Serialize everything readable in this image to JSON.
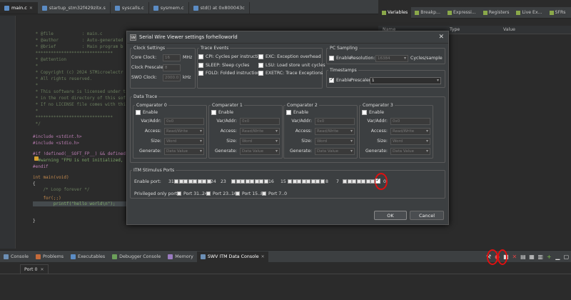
{
  "editor_tabs": [
    {
      "label": "main.c",
      "active": true
    },
    {
      "label": "startup_stm32f429zitx.s",
      "active": false
    },
    {
      "label": "syscalls.c",
      "active": false
    },
    {
      "label": "sysmem.c",
      "active": false
    },
    {
      "label": "std() at 0x800043c",
      "active": false
    }
  ],
  "view_tabs": [
    {
      "label": "Variables",
      "active": true
    },
    {
      "label": "Breakp...",
      "active": false
    },
    {
      "label": "Expressi...",
      "active": false
    },
    {
      "label": "Registers",
      "active": false
    },
    {
      "label": "Live Ex...",
      "active": false
    },
    {
      "label": "SFRs",
      "active": false
    }
  ],
  "variables_header": {
    "name": "Name",
    "type": "Type",
    "value": "Value"
  },
  "code_lines": {
    "l1": " * @file           : main.c",
    "l2": " * @author         : Auto-generated",
    "l3": " * @brief          : Main program b",
    "l4": " ******************************",
    "l5": " * @attention",
    "l6": " *",
    "l7": " * Copyright (c) 2024 STMicroelectr",
    "l8": " * All rights reserved.",
    "l9": " *",
    "l10": " * This software is licensed under t",
    "l11": " * in the root directory of this sof",
    "l12": " * If no LICENSE file comes with thi",
    "l13": " *",
    "l14": " ******************************",
    "l15": " */",
    "l16": "#include <stdint.h>",
    "l17": "#include <stdio.h>",
    "l18": "#if !defined(__SOFT_FP__) && defined",
    "l19": "  #warning \"FPU is not initialized,",
    "l20": "#endif",
    "l21": "int main(void)",
    "l22": "{",
    "l23": "    /* Loop forever */",
    "l24": "    for(;;)",
    "l25": "        printf(\"hello world\\n\");",
    "l26": "}"
  },
  "dialog": {
    "title": "Serial Wire Viewer settings forhelloworld",
    "clock": {
      "legend": "Clock Settings",
      "core_label": "Core Clock:",
      "core_value": "16",
      "core_unit": "MHz",
      "prescaler_label": "Clock Prescaler:",
      "prescaler_value": "8",
      "swo_label": "SWO Clock:",
      "swo_value": "2000.0",
      "swo_unit": "kHz"
    },
    "trace": {
      "legend": "Trace Events",
      "cpi": "CPI: Cycles per instruction",
      "exc": "EXC: Exception overhead",
      "sleep": "SLEEP: Sleep cycles",
      "lsu": "LSU: Load store unit cycles",
      "fold": "FOLD: Folded instructions",
      "exetrc": "EXETRC: Trace Exceptions"
    },
    "pc": {
      "legend": "PC Sampling",
      "enable": "Enable",
      "resolution_label": "Resolution:",
      "resolution_value": "16384",
      "unit": "Cycles/sample"
    },
    "timestamps": {
      "legend": "Timestamps",
      "enable": "Enable",
      "prescaler_label": "Prescaler:",
      "prescaler_value": "1"
    },
    "data_trace": {
      "legend": "Data Trace",
      "comparators": [
        {
          "title": "Comparator 0"
        },
        {
          "title": "Comparator 1"
        },
        {
          "title": "Comparator 2"
        },
        {
          "title": "Comparator 3"
        }
      ],
      "enable": "Enable",
      "var_label": "Var/Addr:",
      "var_value": "0x0",
      "access_label": "Access:",
      "access_value": "Read/Write",
      "size_label": "Size:",
      "size_value": "Word",
      "generate_label": "Generate:",
      "generate_value": "Data Value"
    },
    "itm": {
      "legend": "ITM Stimulus Ports",
      "enable_port_label": "Enable port:",
      "n31": "31",
      "n24": "24",
      "n23": "23",
      "n16": "16",
      "n15": "15",
      "n8": "8",
      "n7": "7",
      "n0": "0",
      "privileged_label": "Privileged only ports:",
      "priv_ports": [
        "Port 31..24",
        "Port 23..16",
        "Port 15..8",
        "Port 7..0"
      ]
    },
    "ok": "OK",
    "cancel": "Cancel"
  },
  "bottom_tabs": [
    {
      "label": "Console",
      "active": false
    },
    {
      "label": "Problems",
      "active": false
    },
    {
      "label": "Executables",
      "active": false
    },
    {
      "label": "Debugger Console",
      "active": false
    },
    {
      "label": "Memory",
      "active": false
    },
    {
      "label": "SWV ITM Data Console",
      "active": true
    }
  ],
  "port_tab": "Port 0",
  "accent": "#e01010"
}
